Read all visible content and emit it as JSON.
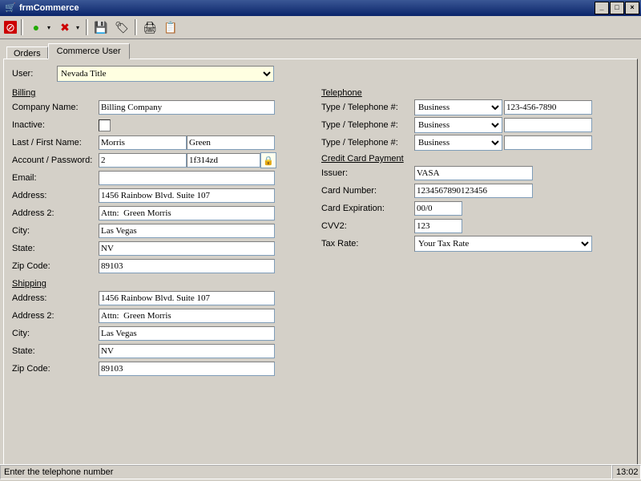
{
  "window": {
    "title": "frmCommerce"
  },
  "tabs": {
    "orders": "Orders",
    "commerce_user": "Commerce User"
  },
  "labels": {
    "user": "User:",
    "billing": "Billing",
    "company_name": "Company Name:",
    "inactive": "Inactive:",
    "last_first": "Last / First Name:",
    "acct_pw": "Account / Password:",
    "email": "Email:",
    "address": "Address:",
    "address2": "Address 2:",
    "city": "City:",
    "state": "State:",
    "zip": "Zip Code:",
    "shipping": "Shipping",
    "telephone": "Telephone",
    "type_tel": "Type / Telephone #:",
    "cc_payment": "Credit Card Payment",
    "issuer": "Issuer:",
    "card_number": "Card Number:",
    "card_exp": "Card Expiration:",
    "cvv2": "CVV2:",
    "tax_rate": "Tax Rate:"
  },
  "values": {
    "user": "Nevada Title",
    "company": "Billing Company",
    "last": "Morris",
    "first": "Green",
    "account": "2",
    "password": "1f314zd",
    "email": "",
    "b_addr": "1456 Rainbow Blvd. Suite 107",
    "b_addr2": "Attn:  Green Morris",
    "b_city": "Las Vegas",
    "b_state": "NV",
    "b_zip": "89103",
    "s_addr": "1456 Rainbow Blvd. Suite 107",
    "s_addr2": "Attn:  Green Morris",
    "s_city": "Las Vegas",
    "s_state": "NV",
    "s_zip": "89103",
    "tel_type1": "Business",
    "tel1": "123-456-7890",
    "tel_type2": "Business",
    "tel2": "",
    "tel_type3": "Business",
    "tel3": "",
    "issuer": "VASA",
    "card_number": "1234567890123456",
    "card_exp": "00/0",
    "cvv2": "123",
    "tax_rate": "Your Tax Rate"
  },
  "status": {
    "message": "Enter the telephone number",
    "time": "13:02"
  }
}
